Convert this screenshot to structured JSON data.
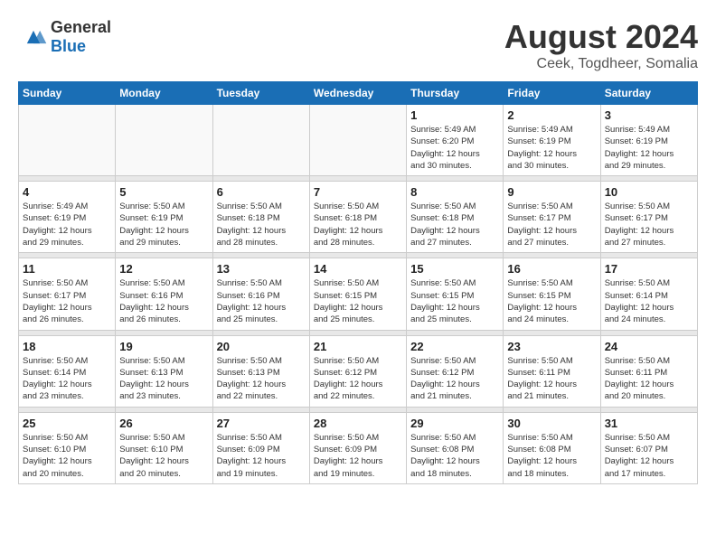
{
  "header": {
    "logo": {
      "text_general": "General",
      "text_blue": "Blue"
    },
    "title": "August 2024",
    "subtitle": "Ceek, Togdheer, Somalia"
  },
  "weekdays": [
    "Sunday",
    "Monday",
    "Tuesday",
    "Wednesday",
    "Thursday",
    "Friday",
    "Saturday"
  ],
  "weeks": [
    [
      {
        "day": "",
        "info": ""
      },
      {
        "day": "",
        "info": ""
      },
      {
        "day": "",
        "info": ""
      },
      {
        "day": "",
        "info": ""
      },
      {
        "day": "1",
        "info": "Sunrise: 5:49 AM\nSunset: 6:20 PM\nDaylight: 12 hours\nand 30 minutes."
      },
      {
        "day": "2",
        "info": "Sunrise: 5:49 AM\nSunset: 6:19 PM\nDaylight: 12 hours\nand 30 minutes."
      },
      {
        "day": "3",
        "info": "Sunrise: 5:49 AM\nSunset: 6:19 PM\nDaylight: 12 hours\nand 29 minutes."
      }
    ],
    [
      {
        "day": "4",
        "info": "Sunrise: 5:49 AM\nSunset: 6:19 PM\nDaylight: 12 hours\nand 29 minutes."
      },
      {
        "day": "5",
        "info": "Sunrise: 5:50 AM\nSunset: 6:19 PM\nDaylight: 12 hours\nand 29 minutes."
      },
      {
        "day": "6",
        "info": "Sunrise: 5:50 AM\nSunset: 6:18 PM\nDaylight: 12 hours\nand 28 minutes."
      },
      {
        "day": "7",
        "info": "Sunrise: 5:50 AM\nSunset: 6:18 PM\nDaylight: 12 hours\nand 28 minutes."
      },
      {
        "day": "8",
        "info": "Sunrise: 5:50 AM\nSunset: 6:18 PM\nDaylight: 12 hours\nand 27 minutes."
      },
      {
        "day": "9",
        "info": "Sunrise: 5:50 AM\nSunset: 6:17 PM\nDaylight: 12 hours\nand 27 minutes."
      },
      {
        "day": "10",
        "info": "Sunrise: 5:50 AM\nSunset: 6:17 PM\nDaylight: 12 hours\nand 27 minutes."
      }
    ],
    [
      {
        "day": "11",
        "info": "Sunrise: 5:50 AM\nSunset: 6:17 PM\nDaylight: 12 hours\nand 26 minutes."
      },
      {
        "day": "12",
        "info": "Sunrise: 5:50 AM\nSunset: 6:16 PM\nDaylight: 12 hours\nand 26 minutes."
      },
      {
        "day": "13",
        "info": "Sunrise: 5:50 AM\nSunset: 6:16 PM\nDaylight: 12 hours\nand 25 minutes."
      },
      {
        "day": "14",
        "info": "Sunrise: 5:50 AM\nSunset: 6:15 PM\nDaylight: 12 hours\nand 25 minutes."
      },
      {
        "day": "15",
        "info": "Sunrise: 5:50 AM\nSunset: 6:15 PM\nDaylight: 12 hours\nand 25 minutes."
      },
      {
        "day": "16",
        "info": "Sunrise: 5:50 AM\nSunset: 6:15 PM\nDaylight: 12 hours\nand 24 minutes."
      },
      {
        "day": "17",
        "info": "Sunrise: 5:50 AM\nSunset: 6:14 PM\nDaylight: 12 hours\nand 24 minutes."
      }
    ],
    [
      {
        "day": "18",
        "info": "Sunrise: 5:50 AM\nSunset: 6:14 PM\nDaylight: 12 hours\nand 23 minutes."
      },
      {
        "day": "19",
        "info": "Sunrise: 5:50 AM\nSunset: 6:13 PM\nDaylight: 12 hours\nand 23 minutes."
      },
      {
        "day": "20",
        "info": "Sunrise: 5:50 AM\nSunset: 6:13 PM\nDaylight: 12 hours\nand 22 minutes."
      },
      {
        "day": "21",
        "info": "Sunrise: 5:50 AM\nSunset: 6:12 PM\nDaylight: 12 hours\nand 22 minutes."
      },
      {
        "day": "22",
        "info": "Sunrise: 5:50 AM\nSunset: 6:12 PM\nDaylight: 12 hours\nand 21 minutes."
      },
      {
        "day": "23",
        "info": "Sunrise: 5:50 AM\nSunset: 6:11 PM\nDaylight: 12 hours\nand 21 minutes."
      },
      {
        "day": "24",
        "info": "Sunrise: 5:50 AM\nSunset: 6:11 PM\nDaylight: 12 hours\nand 20 minutes."
      }
    ],
    [
      {
        "day": "25",
        "info": "Sunrise: 5:50 AM\nSunset: 6:10 PM\nDaylight: 12 hours\nand 20 minutes."
      },
      {
        "day": "26",
        "info": "Sunrise: 5:50 AM\nSunset: 6:10 PM\nDaylight: 12 hours\nand 20 minutes."
      },
      {
        "day": "27",
        "info": "Sunrise: 5:50 AM\nSunset: 6:09 PM\nDaylight: 12 hours\nand 19 minutes."
      },
      {
        "day": "28",
        "info": "Sunrise: 5:50 AM\nSunset: 6:09 PM\nDaylight: 12 hours\nand 19 minutes."
      },
      {
        "day": "29",
        "info": "Sunrise: 5:50 AM\nSunset: 6:08 PM\nDaylight: 12 hours\nand 18 minutes."
      },
      {
        "day": "30",
        "info": "Sunrise: 5:50 AM\nSunset: 6:08 PM\nDaylight: 12 hours\nand 18 minutes."
      },
      {
        "day": "31",
        "info": "Sunrise: 5:50 AM\nSunset: 6:07 PM\nDaylight: 12 hours\nand 17 minutes."
      }
    ]
  ]
}
